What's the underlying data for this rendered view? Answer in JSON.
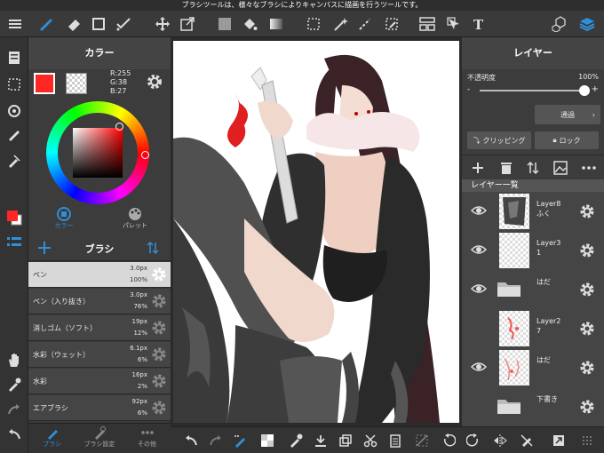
{
  "hint": "ブラシツールは、様々なブラシによりキャンバスに描画を行うツールです。",
  "colors": {
    "accent": "#2f8fd8",
    "primary": "#ff2626",
    "bg": "#2b2b2b"
  },
  "color_panel": {
    "title": "カラー",
    "r": "R:255",
    "g": "G:38",
    "b": "B:27",
    "tab_color": "カラー",
    "tab_palette": "パレット"
  },
  "brush_panel": {
    "title": "ブラシ",
    "brushes": [
      {
        "name": "ペン",
        "size": "3.0px",
        "opacity": "100%"
      },
      {
        "name": "ペン（入り抜き）",
        "size": "3.0px",
        "opacity": "76%"
      },
      {
        "name": "消しゴム（ソフト）",
        "size": "19px",
        "opacity": "12%"
      },
      {
        "name": "水彩（ウェット）",
        "size": "6.1px",
        "opacity": "6%"
      },
      {
        "name": "水彩",
        "size": "16px",
        "opacity": "2%"
      },
      {
        "name": "エアブラシ",
        "size": "92px",
        "opacity": "6%"
      }
    ],
    "tab_brush": "ブラシ",
    "tab_settings": "ブラシ設定",
    "tab_more": "その他"
  },
  "layer_panel": {
    "title": "レイヤー",
    "opacity_label": "不透明度",
    "opacity_value": "100%",
    "opacity_fraction": 1.0,
    "blend_mode": "通過",
    "clipping": "クリッピング",
    "lock": "ロック",
    "list_header": "レイヤー一覧",
    "layers": [
      {
        "name": "Layer8\nふく",
        "type": "layer",
        "visible": true
      },
      {
        "name": "Layer3\n1",
        "type": "layer",
        "visible": true
      },
      {
        "name": "はだ",
        "type": "folder",
        "visible": true
      },
      {
        "name": "Layer2\n7",
        "type": "layer",
        "visible": false
      },
      {
        "name": "はだ",
        "type": "layer",
        "visible": true
      },
      {
        "name": "下書き",
        "type": "folder",
        "visible": false
      }
    ]
  }
}
